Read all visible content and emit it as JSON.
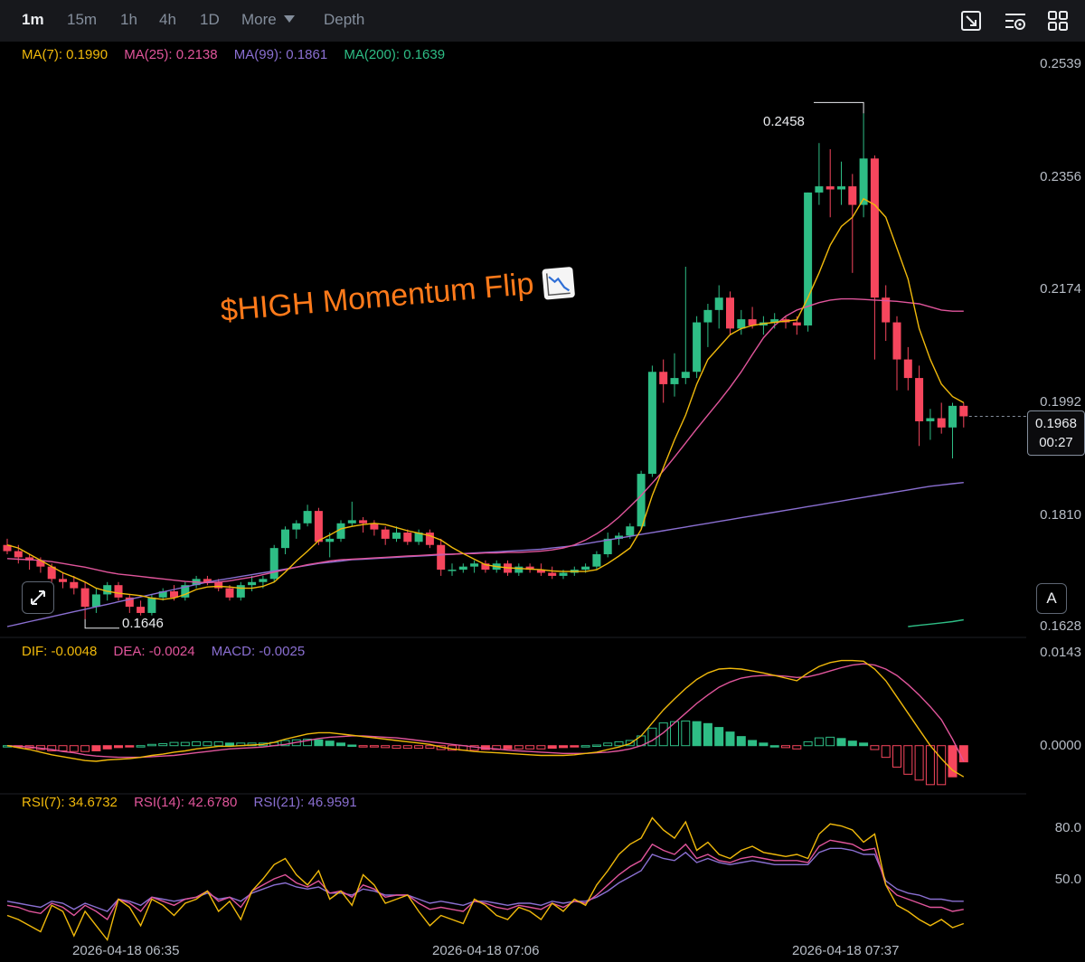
{
  "toolbar": {
    "timeframes": [
      "1m",
      "15m",
      "1h",
      "4h",
      "1D"
    ],
    "active_timeframe": "1m",
    "more_label": "More",
    "depth_label": "Depth",
    "icons": [
      "crop-icon",
      "settings-icon",
      "grid-icon"
    ]
  },
  "legend": {
    "ma7": "MA(7): 0.1990",
    "ma25": "MA(25): 0.2138",
    "ma99": "MA(99): 0.1861",
    "ma200": "MA(200): 0.1639",
    "dif": "DIF: -0.0048",
    "dea": "DEA: -0.0024",
    "macd": "MACD: -0.0025",
    "rsi7": "RSI(7): 34.6732",
    "rsi14": "RSI(14): 42.6780",
    "rsi21": "RSI(21): 46.9591"
  },
  "colors": {
    "up": "#2ebd85",
    "down": "#f6465d",
    "ma7": "#f0b90b",
    "ma25": "#e0559b",
    "ma99": "#8a6fd1",
    "ma200": "#2ebd85",
    "headline": "#ff7a1a"
  },
  "price_axis": [
    "0.2539",
    "0.2356",
    "0.2174",
    "0.1992",
    "0.1810",
    "0.1628"
  ],
  "macd_axis": [
    "0.0143",
    "0.0000"
  ],
  "rsi_axis": [
    "80.0",
    "50.0"
  ],
  "time_labels": [
    "2026-04-18 06:35",
    "2026-04-18 07:06",
    "2026-04-18 07:37"
  ],
  "current_price": "0.1968",
  "countdown": "00:27",
  "high_marker": "0.2458",
  "low_marker": "0.1646",
  "auto_button": "A",
  "headline": "$HIGH  Momentum Flip",
  "chart_data": {
    "type": "candlestick",
    "interval": "1m",
    "price_range": [
      0.1628,
      0.2539
    ],
    "candles_ohlc": [
      [
        0.176,
        0.177,
        0.1745,
        0.175
      ],
      [
        0.175,
        0.176,
        0.173,
        0.174
      ],
      [
        0.174,
        0.1745,
        0.172,
        0.1735
      ],
      [
        0.1735,
        0.174,
        0.1715,
        0.1725
      ],
      [
        0.1725,
        0.173,
        0.17,
        0.1705
      ],
      [
        0.1705,
        0.1715,
        0.169,
        0.17
      ],
      [
        0.17,
        0.171,
        0.168,
        0.169
      ],
      [
        0.169,
        0.17,
        0.164,
        0.166
      ],
      [
        0.166,
        0.169,
        0.165,
        0.168
      ],
      [
        0.168,
        0.17,
        0.167,
        0.1695
      ],
      [
        0.1695,
        0.17,
        0.167,
        0.1675
      ],
      [
        0.1675,
        0.168,
        0.165,
        0.166
      ],
      [
        0.166,
        0.167,
        0.1646,
        0.165
      ],
      [
        0.165,
        0.168,
        0.1646,
        0.1675
      ],
      [
        0.1675,
        0.169,
        0.167,
        0.1685
      ],
      [
        0.1685,
        0.1695,
        0.167,
        0.1675
      ],
      [
        0.1675,
        0.17,
        0.167,
        0.1695
      ],
      [
        0.1695,
        0.171,
        0.169,
        0.1705
      ],
      [
        0.1705,
        0.171,
        0.1695,
        0.17
      ],
      [
        0.17,
        0.1705,
        0.1685,
        0.169
      ],
      [
        0.169,
        0.1695,
        0.167,
        0.1675
      ],
      [
        0.1675,
        0.17,
        0.167,
        0.1695
      ],
      [
        0.1695,
        0.171,
        0.1685,
        0.17
      ],
      [
        0.17,
        0.171,
        0.169,
        0.1705
      ],
      [
        0.1705,
        0.176,
        0.17,
        0.1755
      ],
      [
        0.1755,
        0.179,
        0.1745,
        0.1785
      ],
      [
        0.1785,
        0.18,
        0.177,
        0.1795
      ],
      [
        0.1795,
        0.1825,
        0.179,
        0.1815
      ],
      [
        0.1815,
        0.182,
        0.176,
        0.1765
      ],
      [
        0.1765,
        0.178,
        0.174,
        0.177
      ],
      [
        0.177,
        0.18,
        0.1765,
        0.1795
      ],
      [
        0.1795,
        0.183,
        0.179,
        0.18
      ],
      [
        0.18,
        0.1805,
        0.178,
        0.1795
      ],
      [
        0.1795,
        0.18,
        0.1775,
        0.1785
      ],
      [
        0.1785,
        0.179,
        0.176,
        0.177
      ],
      [
        0.177,
        0.179,
        0.1765,
        0.178
      ],
      [
        0.178,
        0.1785,
        0.176,
        0.1765
      ],
      [
        0.1765,
        0.1785,
        0.176,
        0.178
      ],
      [
        0.178,
        0.1785,
        0.1755,
        0.176
      ],
      [
        0.176,
        0.177,
        0.171,
        0.172
      ],
      [
        0.172,
        0.173,
        0.171,
        0.172
      ],
      [
        0.172,
        0.173,
        0.1715,
        0.1725
      ],
      [
        0.1725,
        0.1735,
        0.1715,
        0.173
      ],
      [
        0.173,
        0.1735,
        0.1715,
        0.172
      ],
      [
        0.172,
        0.1735,
        0.1715,
        0.173
      ],
      [
        0.173,
        0.1735,
        0.171,
        0.1715
      ],
      [
        0.1715,
        0.173,
        0.171,
        0.1725
      ],
      [
        0.1725,
        0.173,
        0.1715,
        0.172
      ],
      [
        0.172,
        0.173,
        0.171,
        0.1715
      ],
      [
        0.1715,
        0.1725,
        0.1705,
        0.171
      ],
      [
        0.171,
        0.172,
        0.1705,
        0.1715
      ],
      [
        0.1715,
        0.1725,
        0.171,
        0.172
      ],
      [
        0.172,
        0.173,
        0.1715,
        0.1725
      ],
      [
        0.1725,
        0.175,
        0.172,
        0.1745
      ],
      [
        0.1745,
        0.178,
        0.174,
        0.177
      ],
      [
        0.177,
        0.178,
        0.176,
        0.1775
      ],
      [
        0.1775,
        0.1795,
        0.177,
        0.179
      ],
      [
        0.179,
        0.188,
        0.1785,
        0.1875
      ],
      [
        0.1875,
        0.205,
        0.187,
        0.204
      ],
      [
        0.204,
        0.206,
        0.199,
        0.202
      ],
      [
        0.202,
        0.207,
        0.2,
        0.203
      ],
      [
        0.203,
        0.221,
        0.202,
        0.204
      ],
      [
        0.204,
        0.213,
        0.203,
        0.212
      ],
      [
        0.212,
        0.215,
        0.208,
        0.214
      ],
      [
        0.214,
        0.218,
        0.211,
        0.216
      ],
      [
        0.216,
        0.217,
        0.21,
        0.211
      ],
      [
        0.211,
        0.214,
        0.21,
        0.2125
      ],
      [
        0.2125,
        0.2145,
        0.211,
        0.2115
      ],
      [
        0.2115,
        0.213,
        0.21,
        0.212
      ],
      [
        0.212,
        0.2135,
        0.211,
        0.2125
      ],
      [
        0.2125,
        0.213,
        0.211,
        0.212
      ],
      [
        0.212,
        0.213,
        0.21,
        0.2115
      ],
      [
        0.2115,
        0.233,
        0.2105,
        0.233
      ],
      [
        0.233,
        0.241,
        0.231,
        0.234
      ],
      [
        0.234,
        0.24,
        0.229,
        0.2335
      ],
      [
        0.2335,
        0.238,
        0.231,
        0.234
      ],
      [
        0.234,
        0.236,
        0.22,
        0.231
      ],
      [
        0.231,
        0.2458,
        0.229,
        0.2385
      ],
      [
        0.2385,
        0.239,
        0.206,
        0.216
      ],
      [
        0.216,
        0.218,
        0.209,
        0.212
      ],
      [
        0.212,
        0.213,
        0.201,
        0.206
      ],
      [
        0.206,
        0.208,
        0.201,
        0.203
      ],
      [
        0.203,
        0.205,
        0.192,
        0.196
      ],
      [
        0.196,
        0.198,
        0.193,
        0.1965
      ],
      [
        0.1965,
        0.199,
        0.194,
        0.195
      ],
      [
        0.195,
        0.199,
        0.19,
        0.1985
      ],
      [
        0.1985,
        0.199,
        0.195,
        0.1968
      ]
    ],
    "ma7": [
      0.176,
      0.1755,
      0.1745,
      0.1735,
      0.1725,
      0.1715,
      0.1708,
      0.17,
      0.169,
      0.1685,
      0.1682,
      0.168,
      0.1678,
      0.1674,
      0.1672,
      0.1674,
      0.168,
      0.1688,
      0.1692,
      0.1693,
      0.1692,
      0.169,
      0.169,
      0.1693,
      0.17,
      0.1716,
      0.1734,
      0.175,
      0.1767,
      0.1776,
      0.1786,
      0.179,
      0.1793,
      0.1795,
      0.1793,
      0.1788,
      0.1783,
      0.1779,
      0.1775,
      0.1768,
      0.1756,
      0.1746,
      0.1737,
      0.1728,
      0.1725,
      0.1723,
      0.1722,
      0.1721,
      0.172,
      0.1718,
      0.1717,
      0.1717,
      0.1717,
      0.172,
      0.173,
      0.1742,
      0.1755,
      0.1785,
      0.184,
      0.1885,
      0.193,
      0.197,
      0.202,
      0.206,
      0.208,
      0.21,
      0.211,
      0.2115,
      0.2118,
      0.212,
      0.2122,
      0.2124,
      0.216,
      0.22,
      0.2245,
      0.2275,
      0.229,
      0.232,
      0.231,
      0.229,
      0.224,
      0.219,
      0.211,
      0.206,
      0.202,
      0.2,
      0.199
    ],
    "ma25": [
      0.1738,
      0.1737,
      0.1736,
      0.1735,
      0.1733,
      0.173,
      0.1727,
      0.1724,
      0.172,
      0.1716,
      0.1713,
      0.1711,
      0.1709,
      0.1707,
      0.1705,
      0.1703,
      0.1701,
      0.17,
      0.1699,
      0.17,
      0.1702,
      0.1705,
      0.1708,
      0.1712,
      0.1716,
      0.172,
      0.1724,
      0.1728,
      0.1731,
      0.1734,
      0.1736,
      0.1737,
      0.1738,
      0.1739,
      0.174,
      0.1741,
      0.1742,
      0.1743,
      0.1744,
      0.1745,
      0.1745,
      0.1746,
      0.1746,
      0.1747,
      0.1747,
      0.1748,
      0.1748,
      0.1749,
      0.175,
      0.1752,
      0.1755,
      0.176,
      0.1768,
      0.1778,
      0.179,
      0.1805,
      0.1822,
      0.184,
      0.186,
      0.188,
      0.1902,
      0.1925,
      0.1948,
      0.197,
      0.1992,
      0.2015,
      0.204,
      0.2068,
      0.2095,
      0.2115,
      0.213,
      0.214,
      0.2146,
      0.2152,
      0.2156,
      0.2158,
      0.2158,
      0.2157,
      0.2156,
      0.2155,
      0.2154,
      0.2152,
      0.215,
      0.2145,
      0.214,
      0.2138,
      0.2138
    ],
    "ma99": [
      0.1628,
      0.1632,
      0.1636,
      0.164,
      0.1644,
      0.1648,
      0.1652,
      0.1656,
      0.166,
      0.1664,
      0.1668,
      0.1672,
      0.1676,
      0.168,
      0.1684,
      0.1688,
      0.1692,
      0.1696,
      0.17,
      0.1703,
      0.1706,
      0.1709,
      0.1712,
      0.1715,
      0.1718,
      0.1721,
      0.1724,
      0.1727,
      0.173,
      0.1732,
      0.1734,
      0.1736,
      0.1737,
      0.1738,
      0.1739,
      0.174,
      0.1741,
      0.1742,
      0.1743,
      0.1744,
      0.1745,
      0.1746,
      0.1747,
      0.1748,
      0.1749,
      0.175,
      0.1751,
      0.1752,
      0.1753,
      0.1755,
      0.1757,
      0.1759,
      0.1762,
      0.1765,
      0.1768,
      0.1771,
      0.1774,
      0.1777,
      0.178,
      0.1783,
      0.1786,
      0.1789,
      0.1792,
      0.1795,
      0.1798,
      0.1801,
      0.1804,
      0.1807,
      0.181,
      0.1813,
      0.1816,
      0.1819,
      0.1822,
      0.1825,
      0.1828,
      0.1831,
      0.1834,
      0.1837,
      0.184,
      0.1843,
      0.1846,
      0.1849,
      0.1852,
      0.1855,
      0.1857,
      0.1859,
      0.1861
    ],
    "ma200_tail": [
      0.1628,
      0.163,
      0.1632,
      0.1634,
      0.1636,
      0.1639
    ],
    "macd_range": [
      -0.007,
      0.0143
    ],
    "dif": [
      0.0,
      -0.0003,
      -0.0006,
      -0.001,
      -0.0014,
      -0.0017,
      -0.002,
      -0.0023,
      -0.0024,
      -0.0022,
      -0.0021,
      -0.002,
      -0.0018,
      -0.0015,
      -0.0013,
      -0.001,
      -0.0008,
      -0.0005,
      -0.0003,
      -0.0001,
      -0.0001,
      0.0,
      0.0001,
      0.0002,
      0.0005,
      0.001,
      0.0014,
      0.0018,
      0.002,
      0.002,
      0.0018,
      0.0016,
      0.0014,
      0.0012,
      0.001,
      0.0008,
      0.0006,
      0.0004,
      0.0002,
      -0.0002,
      -0.0005,
      -0.0007,
      -0.0009,
      -0.001,
      -0.0011,
      -0.0012,
      -0.0013,
      -0.0014,
      -0.0015,
      -0.0015,
      -0.0015,
      -0.0014,
      -0.0012,
      -0.001,
      -0.0006,
      -0.0002,
      0.0003,
      0.0015,
      0.0035,
      0.0055,
      0.0072,
      0.0088,
      0.0102,
      0.0112,
      0.0118,
      0.0119,
      0.0118,
      0.0115,
      0.0112,
      0.0108,
      0.0104,
      0.01,
      0.0112,
      0.0122,
      0.0128,
      0.0131,
      0.0131,
      0.013,
      0.0118,
      0.01,
      0.0075,
      0.005,
      0.0025,
      0.0,
      -0.002,
      -0.0038,
      -0.0048
    ],
    "dea": [
      0.0,
      -0.0001,
      -0.0002,
      -0.0004,
      -0.0006,
      -0.0009,
      -0.0011,
      -0.0014,
      -0.0016,
      -0.0017,
      -0.0018,
      -0.0018,
      -0.0018,
      -0.0017,
      -0.0016,
      -0.0015,
      -0.0013,
      -0.0011,
      -0.0009,
      -0.0007,
      -0.0005,
      -0.0004,
      -0.0003,
      -0.0002,
      0.0,
      0.0002,
      0.0005,
      0.0008,
      0.0011,
      0.0013,
      0.0014,
      0.0015,
      0.0015,
      0.0014,
      0.0013,
      0.0012,
      0.001,
      0.0008,
      0.0006,
      0.0004,
      0.0002,
      0.0,
      -0.0002,
      -0.0004,
      -0.0005,
      -0.0007,
      -0.0008,
      -0.0009,
      -0.001,
      -0.0011,
      -0.0012,
      -0.0012,
      -0.0012,
      -0.0011,
      -0.001,
      -0.0008,
      -0.0005,
      0.0,
      0.0008,
      0.002,
      0.0035,
      0.005,
      0.0065,
      0.0078,
      0.009,
      0.0098,
      0.0104,
      0.0107,
      0.0108,
      0.0108,
      0.0107,
      0.0105,
      0.0106,
      0.011,
      0.0115,
      0.012,
      0.0124,
      0.0126,
      0.0124,
      0.0118,
      0.0108,
      0.0094,
      0.0078,
      0.006,
      0.004,
      0.001,
      -0.0024
    ],
    "macd_hist": [
      0.0,
      -0.0002,
      -0.0004,
      -0.0006,
      -0.0008,
      -0.0008,
      -0.0009,
      -0.0009,
      -0.0008,
      -0.0005,
      -0.0003,
      -0.0002,
      0.0,
      0.0002,
      0.0003,
      0.0005,
      0.0005,
      0.0006,
      0.0006,
      0.0006,
      0.0004,
      0.0004,
      0.0004,
      0.0004,
      0.0005,
      0.0008,
      0.0009,
      0.001,
      0.0009,
      0.0007,
      0.0004,
      0.0001,
      -0.0001,
      -0.0002,
      -0.0003,
      -0.0004,
      -0.0004,
      -0.0004,
      -0.0004,
      -0.0006,
      -0.0007,
      -0.0007,
      -0.0007,
      -0.0006,
      -0.0006,
      -0.0005,
      -0.0005,
      -0.0005,
      -0.0005,
      -0.0004,
      -0.0003,
      -0.0002,
      0.0,
      0.0001,
      0.0004,
      0.0006,
      0.0008,
      0.0015,
      0.0027,
      0.0035,
      0.0037,
      0.0038,
      0.0037,
      0.0034,
      0.0028,
      0.0021,
      0.0014,
      0.0008,
      0.0004,
      0.0,
      -0.0003,
      -0.0005,
      0.0006,
      0.0012,
      0.0013,
      0.0011,
      0.0007,
      0.0004,
      -0.0006,
      -0.0018,
      -0.0033,
      -0.0044,
      -0.0053,
      -0.006,
      -0.006,
      -0.0048,
      -0.0025
    ],
    "rsi_range": [
      30,
      90
    ],
    "rsi7": [
      40,
      38,
      35,
      32,
      45,
      42,
      30,
      42,
      35,
      28,
      48,
      44,
      35,
      48,
      45,
      40,
      46,
      48,
      52,
      42,
      47,
      38,
      52,
      58,
      65,
      68,
      60,
      55,
      62,
      48,
      52,
      45,
      60,
      55,
      46,
      48,
      50,
      42,
      35,
      40,
      38,
      36,
      48,
      45,
      40,
      38,
      44,
      42,
      38,
      46,
      42,
      48,
      45,
      55,
      62,
      70,
      75,
      78,
      88,
      82,
      78,
      86,
      72,
      76,
      70,
      68,
      72,
      74,
      71,
      70,
      69,
      70,
      68,
      80,
      85,
      84,
      82,
      76,
      80,
      55,
      45,
      42,
      38,
      35,
      38,
      34,
      36
    ],
    "rsi14": [
      45,
      44,
      42,
      41,
      46,
      44,
      40,
      45,
      42,
      38,
      48,
      46,
      42,
      49,
      47,
      45,
      48,
      49,
      52,
      47,
      49,
      44,
      52,
      55,
      58,
      60,
      56,
      54,
      57,
      51,
      52,
      49,
      55,
      53,
      49,
      50,
      50,
      46,
      43,
      44,
      43,
      42,
      47,
      46,
      44,
      43,
      45,
      44,
      43,
      46,
      44,
      47,
      46,
      50,
      55,
      60,
      64,
      67,
      75,
      72,
      70,
      75,
      68,
      70,
      67,
      66,
      68,
      69,
      68,
      67,
      67,
      67,
      66,
      74,
      77,
      76,
      75,
      72,
      73,
      55,
      50,
      48,
      46,
      44,
      44,
      42,
      43
    ],
    "rsi21": [
      47,
      46,
      45,
      44,
      47,
      46,
      43,
      46,
      44,
      42,
      48,
      47,
      45,
      49,
      48,
      47,
      48,
      49,
      51,
      48,
      49,
      47,
      51,
      53,
      55,
      56,
      54,
      53,
      54,
      51,
      51,
      50,
      53,
      52,
      50,
      50,
      50,
      48,
      46,
      47,
      46,
      45,
      47,
      47,
      46,
      45,
      46,
      46,
      45,
      47,
      46,
      47,
      47,
      49,
      52,
      56,
      59,
      62,
      70,
      68,
      67,
      71,
      66,
      68,
      66,
      65,
      66,
      67,
      66,
      65,
      65,
      65,
      65,
      71,
      73,
      73,
      72,
      70,
      70,
      57,
      53,
      51,
      50,
      48,
      48,
      47,
      47
    ]
  }
}
